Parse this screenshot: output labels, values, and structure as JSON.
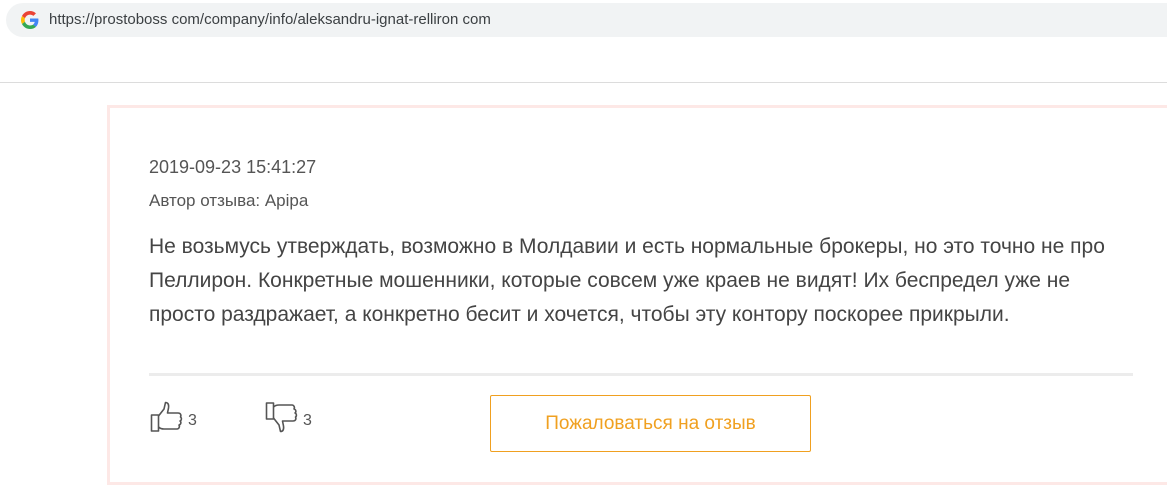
{
  "browser": {
    "url": "https://prostoboss com/company/info/aleksandru-ignat-relliron com",
    "search_engine_icon": "google-g-icon"
  },
  "review": {
    "date": "2019-09-23 15:41:27",
    "author": "Автор отзыва: Apipa",
    "text": "Не возьмусь утверждать, возможно в Молдавии и есть нормальные брокеры, но это точно не про Пеллирон. Конкретные мошенники, которые совсем уже краев не видят! Их беспредел уже не просто раздражает, а конкретно бесит и хочется, чтобы эту контору поскорее прикрыли.",
    "likes": "3",
    "dislikes": "3",
    "like_icon": "thumbs-up-icon",
    "dislike_icon": "thumbs-down-icon",
    "complain_label": "Пожаловаться на отзыв"
  },
  "colors": {
    "accent": "#f0a020",
    "card_border": "#fde8e6",
    "text": "#444444"
  }
}
